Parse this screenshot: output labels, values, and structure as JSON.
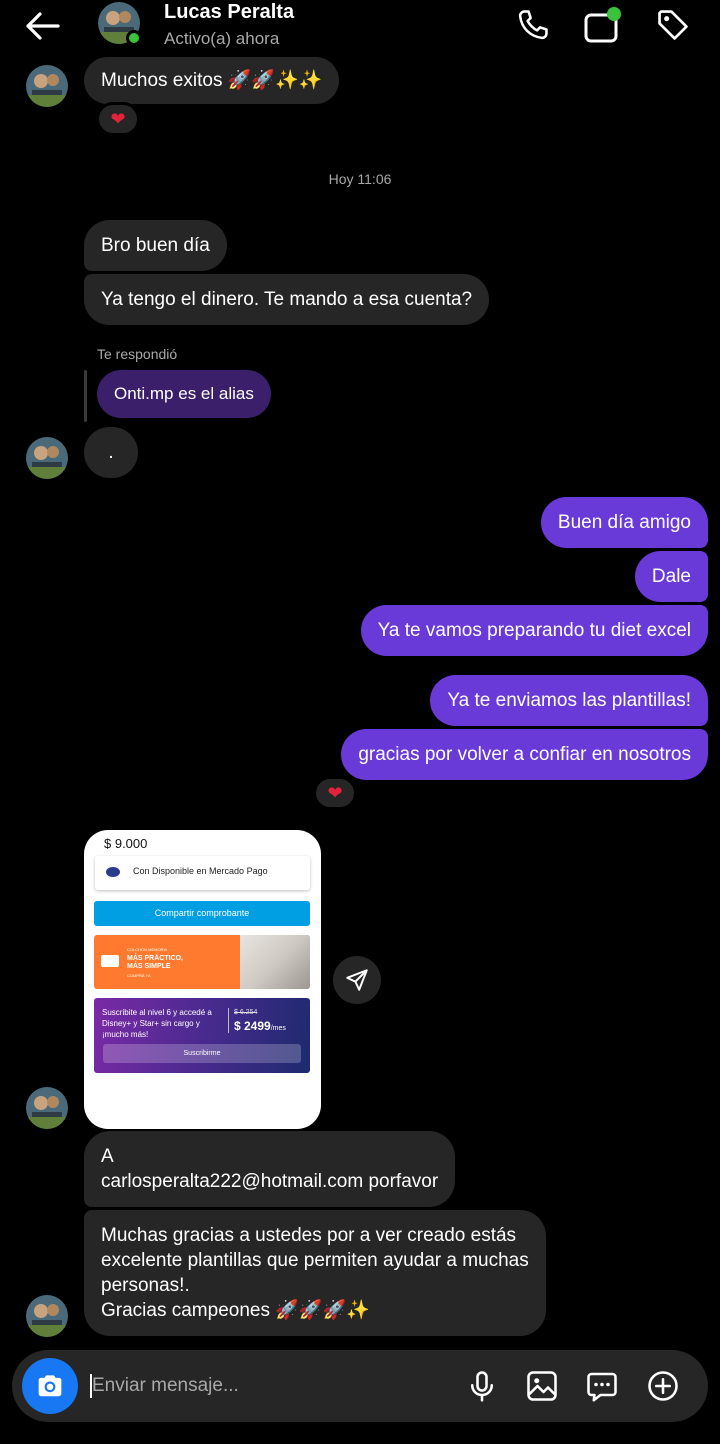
{
  "header": {
    "name": "Lucas Peralta",
    "status": "Activo(a) ahora"
  },
  "messages": {
    "m0": "Muchos exitos 🚀🚀✨✨",
    "m0_reaction": "❤",
    "timestamp": "Hoy 11:06",
    "m1": "Bro buen día",
    "m2": "Ya tengo el dinero. Te mando a esa cuenta?",
    "replied_label": "Te respondió",
    "reply_quote": "Onti.mp es el alias",
    "m3": ".",
    "o1": "Buen día amigo",
    "o2": "Dale",
    "o3": "Ya te vamos preparando tu diet excel",
    "o4": "Ya te enviamos las plantillas!",
    "o5": "gracias por volver a confiar en nosotros",
    "o5_reaction": "❤",
    "m4_line1": "A",
    "m4_line2": "carlosperalta222@hotmail.com porfavor",
    "m5_line1": "Muchas gracias a ustedes por a ver creado estás",
    "m5_line2": "excelente plantillas que permiten ayudar a muchas",
    "m5_line3": "personas!.",
    "m5_line4": "Gracias campeones 🚀🚀🚀✨"
  },
  "shared_card": {
    "amount": "$ 9.000",
    "account": "Con Disponible en Mercado Pago",
    "share_button": "Compartir comprobante",
    "promo_small": "COLCHÓN MEMORIA",
    "promo_title_1": "MÁS PRÁCTICO,",
    "promo_title_2": "MÁS SIMPLE",
    "promo_tiny": "COMPRÁ YA",
    "sub_text": "Suscribite al nivel 6 y accedé a Disney+ y Star+ sin cargo y ¡mucho más!",
    "old_price": "$ 6.254",
    "price": "$ 2499",
    "price_unit": "/mes",
    "subscribe_button": "Suscribirme"
  },
  "composer": {
    "placeholder": "Enviar mensaje..."
  },
  "colors": {
    "outgoing": "#6a3ad8",
    "incoming": "#262626",
    "reply_quote": "#3b1f6b",
    "camera": "#1877f2",
    "online": "#3ac23a"
  },
  "icons": [
    "back-arrow-icon",
    "phone-icon",
    "video-icon",
    "tag-icon",
    "heart-icon",
    "send-icon",
    "camera-icon",
    "microphone-icon",
    "gallery-icon",
    "sticker-icon",
    "plus-icon"
  ]
}
